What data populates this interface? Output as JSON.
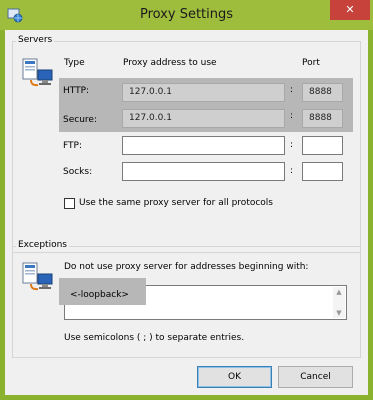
{
  "window": {
    "title": "Proxy Settings",
    "close_glyph": "✕"
  },
  "servers": {
    "group_label": "Servers",
    "headers": {
      "type": "Type",
      "address": "Proxy address to use",
      "port": "Port"
    },
    "rows": [
      {
        "label": "HTTP:",
        "address": "127.0.0.1",
        "port": "8888"
      },
      {
        "label": "Secure:",
        "address": "127.0.0.1",
        "port": "8888"
      },
      {
        "label": "FTP:",
        "address": "",
        "port": ""
      },
      {
        "label": "Socks:",
        "address": "",
        "port": ""
      }
    ],
    "colon": ":",
    "same_proxy_label": "Use the same proxy server for all protocols",
    "same_proxy_checked": false
  },
  "exceptions": {
    "group_label": "Exceptions",
    "instruction": "Do not use proxy server for addresses beginning with:",
    "value": "<-loopback>",
    "hint": "Use semicolons ( ; ) to separate entries."
  },
  "buttons": {
    "ok": "OK",
    "cancel": "Cancel"
  },
  "icons": {
    "app": "proxy-settings-icon",
    "servers": "network-computer-icon",
    "exceptions": "network-computer-icon"
  }
}
